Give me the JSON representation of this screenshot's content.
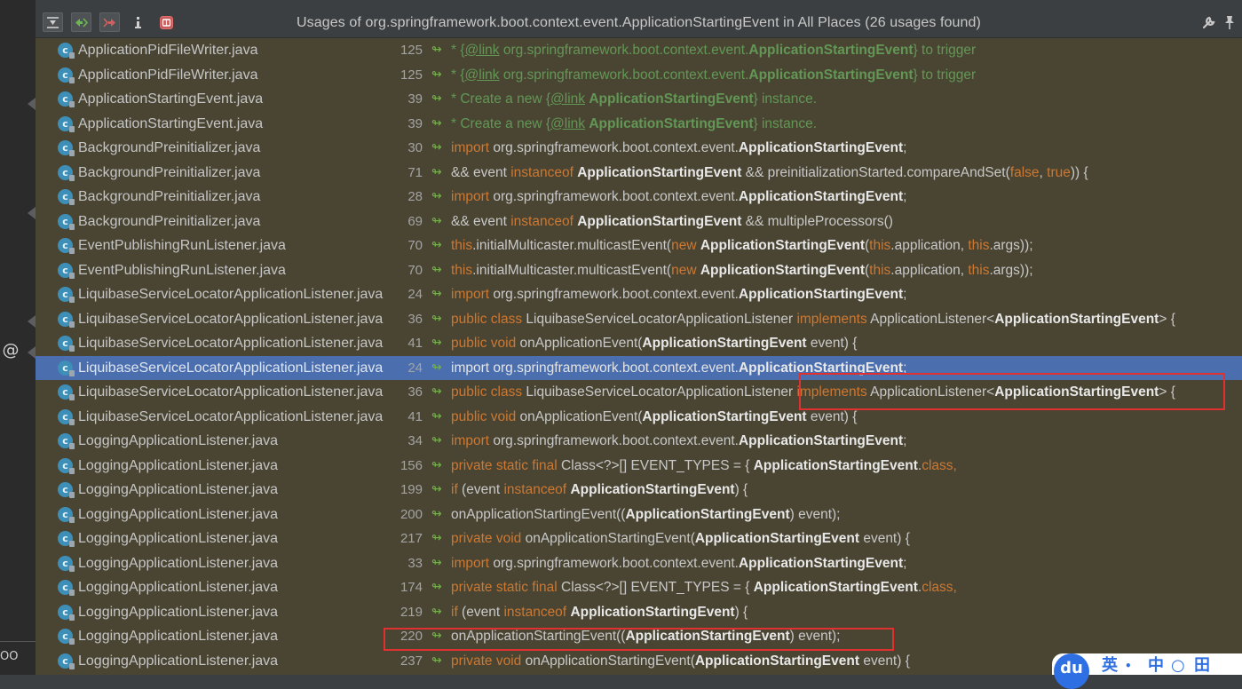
{
  "title": "Usages of org.springframework.boot.context.event.ApplicationStartingEvent in All Places (26 usages found)",
  "strip": {
    "at_symbol": "@",
    "bottom_text": "OO"
  },
  "ime": {
    "logo": "du",
    "items": [
      "英",
      "•",
      "中",
      "○",
      "田"
    ]
  },
  "colors": {
    "popup_bg": "#4a4533",
    "selected_row": "#4b6eaf",
    "keyword": "#cc7832",
    "doc_comment": "#629755",
    "annotation_box": "#e03030"
  },
  "toolbar_icons": [
    "expand-all-icon",
    "previous-usage-icon",
    "next-usage-icon",
    "info-icon",
    "filter-icon"
  ],
  "usages": [
    {
      "file": "ApplicationPidFileWriter.java",
      "line": "125",
      "code": [
        [
          "doc",
          "* {"
        ],
        [
          "doc-tag",
          "@link"
        ],
        [
          "doc",
          " org.springframework.boot.context.event."
        ],
        [
          "doc-hl",
          "ApplicationStartingEvent"
        ],
        [
          "doc",
          "} to trigger"
        ]
      ]
    },
    {
      "file": "ApplicationPidFileWriter.java",
      "line": "125",
      "code": [
        [
          "doc",
          "* {"
        ],
        [
          "doc-tag",
          "@link"
        ],
        [
          "doc",
          " org.springframework.boot.context.event."
        ],
        [
          "doc-hl",
          "ApplicationStartingEvent"
        ],
        [
          "doc",
          "} to trigger"
        ]
      ]
    },
    {
      "file": "ApplicationStartingEvent.java",
      "line": "39",
      "code": [
        [
          "doc",
          "* Create a new {"
        ],
        [
          "doc-tag",
          "@link"
        ],
        [
          "doc",
          " "
        ],
        [
          "doc-hl",
          "ApplicationStartingEvent"
        ],
        [
          "doc",
          "} instance."
        ]
      ]
    },
    {
      "file": "ApplicationStartingEvent.java",
      "line": "39",
      "code": [
        [
          "doc",
          "* Create a new {"
        ],
        [
          "doc-tag",
          "@link"
        ],
        [
          "doc",
          " "
        ],
        [
          "doc-hl",
          "ApplicationStartingEvent"
        ],
        [
          "doc",
          "} instance."
        ]
      ]
    },
    {
      "file": "BackgroundPreinitializer.java",
      "line": "30",
      "code": [
        [
          "kw",
          "import"
        ],
        [
          "t",
          " org.springframework.boot.context.event."
        ],
        [
          "hl",
          "ApplicationStartingEvent"
        ],
        [
          "t",
          ";"
        ]
      ]
    },
    {
      "file": "BackgroundPreinitializer.java",
      "line": "71",
      "code": [
        [
          "t",
          "&& event "
        ],
        [
          "kw",
          "instanceof"
        ],
        [
          "t",
          " "
        ],
        [
          "hl",
          "ApplicationStartingEvent"
        ],
        [
          "t",
          " && preinitializationStarted.compareAndSet("
        ],
        [
          "kw",
          "false"
        ],
        [
          "t",
          ", "
        ],
        [
          "kw",
          "true"
        ],
        [
          "t",
          ")) {"
        ]
      ]
    },
    {
      "file": "BackgroundPreinitializer.java",
      "line": "28",
      "code": [
        [
          "kw",
          "import"
        ],
        [
          "t",
          " org.springframework.boot.context.event."
        ],
        [
          "hl",
          "ApplicationStartingEvent"
        ],
        [
          "t",
          ";"
        ]
      ]
    },
    {
      "file": "BackgroundPreinitializer.java",
      "line": "69",
      "code": [
        [
          "t",
          "&& event "
        ],
        [
          "kw",
          "instanceof"
        ],
        [
          "t",
          " "
        ],
        [
          "hl",
          "ApplicationStartingEvent"
        ],
        [
          "t",
          " && multipleProcessors()"
        ]
      ]
    },
    {
      "file": "EventPublishingRunListener.java",
      "line": "70",
      "code": [
        [
          "kw",
          "this"
        ],
        [
          "t",
          ".initialMulticaster.multicastEvent("
        ],
        [
          "kw",
          "new"
        ],
        [
          "t",
          " "
        ],
        [
          "hl",
          "ApplicationStartingEvent"
        ],
        [
          "t",
          "("
        ],
        [
          "kw",
          "this"
        ],
        [
          "t",
          ".application, "
        ],
        [
          "kw",
          "this"
        ],
        [
          "t",
          ".args));"
        ]
      ]
    },
    {
      "file": "EventPublishingRunListener.java",
      "line": "70",
      "code": [
        [
          "kw",
          "this"
        ],
        [
          "t",
          ".initialMulticaster.multicastEvent("
        ],
        [
          "kw",
          "new"
        ],
        [
          "t",
          " "
        ],
        [
          "hl",
          "ApplicationStartingEvent"
        ],
        [
          "t",
          "("
        ],
        [
          "kw",
          "this"
        ],
        [
          "t",
          ".application, "
        ],
        [
          "kw",
          "this"
        ],
        [
          "t",
          ".args));"
        ]
      ]
    },
    {
      "file": "LiquibaseServiceLocatorApplicationListener.java",
      "line": "24",
      "code": [
        [
          "kw",
          "import"
        ],
        [
          "t",
          " org.springframework.boot.context.event."
        ],
        [
          "hl",
          "ApplicationStartingEvent"
        ],
        [
          "t",
          ";"
        ]
      ]
    },
    {
      "file": "LiquibaseServiceLocatorApplicationListener.java",
      "line": "36",
      "code": [
        [
          "kw",
          "public class"
        ],
        [
          "t",
          " LiquibaseServiceLocatorApplicationListener "
        ],
        [
          "kw",
          "implements"
        ],
        [
          "t",
          " ApplicationListener<"
        ],
        [
          "hl",
          "ApplicationStartingEvent"
        ],
        [
          "t",
          "> {"
        ]
      ]
    },
    {
      "file": "LiquibaseServiceLocatorApplicationListener.java",
      "line": "41",
      "code": [
        [
          "kw",
          "public void"
        ],
        [
          "t",
          " onApplicationEvent("
        ],
        [
          "hl",
          "ApplicationStartingEvent"
        ],
        [
          "t",
          " event) {"
        ]
      ]
    },
    {
      "file": "LiquibaseServiceLocatorApplicationListener.java",
      "line": "24",
      "selected": true,
      "code": [
        [
          "t",
          "import org.springframework.boot.context.event."
        ],
        [
          "hl",
          "ApplicationStartingEvent"
        ],
        [
          "t",
          ";"
        ]
      ]
    },
    {
      "file": "LiquibaseServiceLocatorApplicationListener.java",
      "line": "36",
      "code": [
        [
          "kw",
          "public class"
        ],
        [
          "t",
          " LiquibaseServiceLocatorApplicationListener "
        ],
        [
          "kw",
          "implements"
        ],
        [
          "t",
          " ApplicationListener<"
        ],
        [
          "hl",
          "ApplicationStartingEvent"
        ],
        [
          "t",
          "> {"
        ]
      ]
    },
    {
      "file": "LiquibaseServiceLocatorApplicationListener.java",
      "line": "41",
      "code": [
        [
          "kw",
          "public void"
        ],
        [
          "t",
          " onApplicationEvent("
        ],
        [
          "hl",
          "ApplicationStartingEvent"
        ],
        [
          "t",
          " event) {"
        ]
      ]
    },
    {
      "file": "LoggingApplicationListener.java",
      "line": "34",
      "code": [
        [
          "kw",
          "import"
        ],
        [
          "t",
          " org.springframework.boot.context.event."
        ],
        [
          "hl",
          "ApplicationStartingEvent"
        ],
        [
          "t",
          ";"
        ]
      ]
    },
    {
      "file": "LoggingApplicationListener.java",
      "line": "156",
      "code": [
        [
          "kw",
          "private static final"
        ],
        [
          "t",
          " Class<?>[] EVENT_TYPES = { "
        ],
        [
          "hl",
          "ApplicationStartingEvent"
        ],
        [
          "t",
          "."
        ],
        [
          "kw",
          "class,"
        ]
      ]
    },
    {
      "file": "LoggingApplicationListener.java",
      "line": "199",
      "code": [
        [
          "kw",
          "if"
        ],
        [
          "t",
          " (event "
        ],
        [
          "kw",
          "instanceof"
        ],
        [
          "t",
          " "
        ],
        [
          "hl",
          "ApplicationStartingEvent"
        ],
        [
          "t",
          ") {"
        ]
      ]
    },
    {
      "file": "LoggingApplicationListener.java",
      "line": "200",
      "code": [
        [
          "t",
          "onApplicationStartingEvent(("
        ],
        [
          "hl",
          "ApplicationStartingEvent"
        ],
        [
          "t",
          ") event);"
        ]
      ]
    },
    {
      "file": "LoggingApplicationListener.java",
      "line": "217",
      "code": [
        [
          "kw",
          "private void"
        ],
        [
          "t",
          " onApplicationStartingEvent("
        ],
        [
          "hl",
          "ApplicationStartingEvent"
        ],
        [
          "t",
          " event) {"
        ]
      ]
    },
    {
      "file": "LoggingApplicationListener.java",
      "line": "33",
      "code": [
        [
          "kw",
          "import"
        ],
        [
          "t",
          " org.springframework.boot.context.event."
        ],
        [
          "hl",
          "ApplicationStartingEvent"
        ],
        [
          "t",
          ";"
        ]
      ]
    },
    {
      "file": "LoggingApplicationListener.java",
      "line": "174",
      "code": [
        [
          "kw",
          "private static final"
        ],
        [
          "t",
          " Class<?>[] EVENT_TYPES = { "
        ],
        [
          "hl",
          "ApplicationStartingEvent"
        ],
        [
          "t",
          "."
        ],
        [
          "kw",
          "class,"
        ]
      ]
    },
    {
      "file": "LoggingApplicationListener.java",
      "line": "219",
      "code": [
        [
          "kw",
          "if"
        ],
        [
          "t",
          " (event "
        ],
        [
          "kw",
          "instanceof"
        ],
        [
          "t",
          " "
        ],
        [
          "hl",
          "ApplicationStartingEvent"
        ],
        [
          "t",
          ") {"
        ]
      ]
    },
    {
      "file": "LoggingApplicationListener.java",
      "line": "220",
      "code": [
        [
          "t",
          "onApplicationStartingEvent(("
        ],
        [
          "hl",
          "ApplicationStartingEvent"
        ],
        [
          "t",
          ") event);"
        ]
      ]
    },
    {
      "file": "LoggingApplicationListener.java",
      "line": "237",
      "code": [
        [
          "kw",
          "private void"
        ],
        [
          "t",
          " onApplicationStartingEvent("
        ],
        [
          "hl",
          "ApplicationStartingEvent"
        ],
        [
          "t",
          " event) {"
        ]
      ]
    }
  ]
}
